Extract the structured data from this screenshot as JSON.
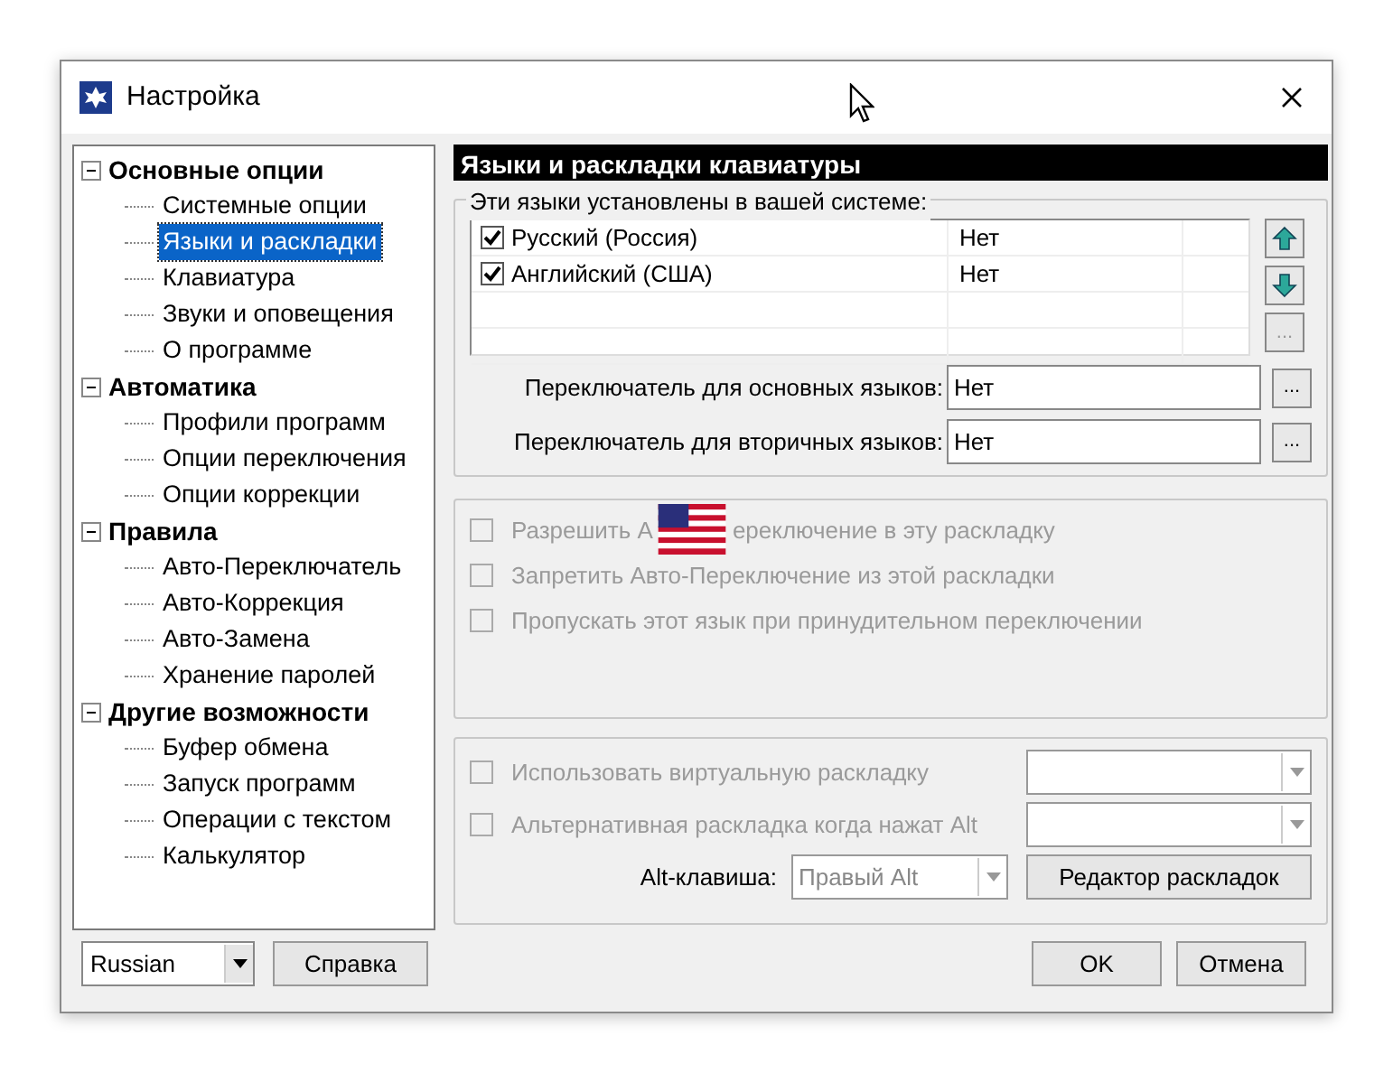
{
  "window": {
    "title": "Настройка"
  },
  "tree": [
    {
      "label": "Основные опции",
      "expanded": true,
      "children": [
        {
          "label": "Системные опции",
          "selected": false
        },
        {
          "label": "Языки и раскладки",
          "selected": true
        },
        {
          "label": "Клавиатура",
          "selected": false
        },
        {
          "label": "Звуки и оповещения",
          "selected": false
        },
        {
          "label": "О программе",
          "selected": false
        }
      ]
    },
    {
      "label": "Автоматика",
      "expanded": true,
      "children": [
        {
          "label": "Профили программ",
          "selected": false
        },
        {
          "label": "Опции переключения",
          "selected": false
        },
        {
          "label": "Опции коррекции",
          "selected": false
        }
      ]
    },
    {
      "label": "Правила",
      "expanded": true,
      "children": [
        {
          "label": "Авто-Переключатель",
          "selected": false
        },
        {
          "label": "Авто-Коррекция",
          "selected": false
        },
        {
          "label": "Авто-Замена",
          "selected": false
        },
        {
          "label": "Хранение паролей",
          "selected": false
        }
      ]
    },
    {
      "label": "Другие возможности",
      "expanded": true,
      "children": [
        {
          "label": "Буфер обмена",
          "selected": false
        },
        {
          "label": "Запуск программ",
          "selected": false
        },
        {
          "label": "Операции с текстом",
          "selected": false
        },
        {
          "label": "Калькулятор",
          "selected": false
        }
      ]
    }
  ],
  "language_select": {
    "value": "Russian"
  },
  "help_button": "Справка",
  "panel_title": "Языки и раскладки клавиатуры",
  "languages_group": {
    "title": "Эти языки установлены в вашей системе:",
    "rows": [
      {
        "name": "Русский (Россия)",
        "checked": true,
        "hotkey": "Нет"
      },
      {
        "name": "Английский (США)",
        "checked": true,
        "hotkey": "Нет"
      }
    ],
    "more_button": "...",
    "hotkeys": [
      {
        "label": "Переключатель для основных языков:",
        "value": "Нет",
        "button": "..."
      },
      {
        "label": "Переключатель для вторичных языков:",
        "value": "Нет",
        "button": "..."
      }
    ]
  },
  "layout_options": [
    {
      "label": "Разрешить А",
      "label_rest": "ереключение в эту раскладку",
      "checked": false,
      "disabled": true
    },
    {
      "label": "Запретить Авто-Переключение из этой раскладки",
      "checked": false,
      "disabled": true
    },
    {
      "label": "Пропускать этот язык при принудительном переключении",
      "checked": false,
      "disabled": true
    }
  ],
  "virtual_options": [
    {
      "label": "Использовать виртуальную раскладку",
      "checked": false,
      "disabled": true
    },
    {
      "label": "Альтернативная раскладка когда нажат Alt",
      "checked": false,
      "disabled": true
    }
  ],
  "alt_key": {
    "label": "Alt-клавиша:",
    "value": "Правый Alt",
    "disabled": true
  },
  "layout_editor_button": "Редактор раскладок",
  "buttons": [
    "OK",
    "Отмена"
  ]
}
